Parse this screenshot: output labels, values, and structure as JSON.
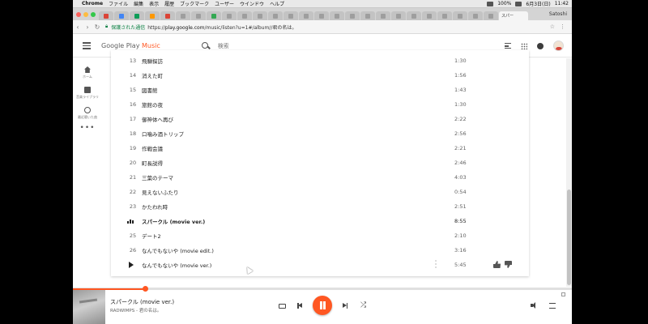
{
  "os_menubar": {
    "app_name": "Chrome",
    "menus": [
      "ファイル",
      "編集",
      "表示",
      "履歴",
      "ブックマーク",
      "ユーザー",
      "ウインドウ",
      "ヘルプ"
    ],
    "battery": "100%",
    "date": "6月3日(日)",
    "time": "11:42"
  },
  "browser": {
    "active_tab_label": "スパー",
    "profile_name": "Satoshi",
    "traffic_light_colors": [
      "#fc605b",
      "#fdbc40",
      "#34c84a"
    ],
    "tab_favicon_colors": [
      "#db4437",
      "#4285f4",
      "#0f9d58",
      "#ff9800",
      "#db4437",
      "#9e9e9e",
      "#9e9e9e",
      "#34a853",
      "#9e9e9e",
      "#9e9e9e",
      "#9e9e9e",
      "#9e9e9e",
      "#9e9e9e",
      "#9e9e9e",
      "#9e9e9e",
      "#9e9e9e",
      "#9e9e9e",
      "#9e9e9e",
      "#9e9e9e",
      "#9e9e9e",
      "#9e9e9e",
      "#9e9e9e",
      "#9e9e9e",
      "#9e9e9e",
      "#9e9e9e",
      "#9e9e9e"
    ],
    "secure_label": "保護された通信",
    "url_scheme": "https://",
    "url_host": "play.google.com",
    "url_path": "/music/listen?u=1#/album//君の名は。"
  },
  "app": {
    "logo_prefix": "Google Play",
    "logo_suffix": "Music",
    "accent_color": "#ff5722",
    "search_placeholder": "検索"
  },
  "leftnav": {
    "items": [
      {
        "label": "ホーム",
        "icon": "home-icon"
      },
      {
        "label": "音楽ライブラリ",
        "icon": "library-icon"
      },
      {
        "label": "最近聴いた曲",
        "icon": "recent-icon"
      }
    ],
    "more_label": "•••"
  },
  "tracks": [
    {
      "num": "13",
      "title": "飛騨探訪",
      "duration": "1:30"
    },
    {
      "num": "14",
      "title": "消えた町",
      "duration": "1:56"
    },
    {
      "num": "15",
      "title": "図書館",
      "duration": "1:43"
    },
    {
      "num": "16",
      "title": "旅館の夜",
      "duration": "1:30"
    },
    {
      "num": "17",
      "title": "御神体へ再び",
      "duration": "2:22"
    },
    {
      "num": "18",
      "title": "口噛み酒トリップ",
      "duration": "2:56"
    },
    {
      "num": "19",
      "title": "作戦会議",
      "duration": "2:21"
    },
    {
      "num": "20",
      "title": "町長説得",
      "duration": "2:46"
    },
    {
      "num": "21",
      "title": "三葉のテーマ",
      "duration": "4:03"
    },
    {
      "num": "22",
      "title": "見えないふたり",
      "duration": "0:54"
    },
    {
      "num": "23",
      "title": "かたわれ時",
      "duration": "2:51"
    },
    {
      "num": "",
      "title": "スパークル (movie ver.)",
      "duration": "8:55",
      "playing": true
    },
    {
      "num": "25",
      "title": "デート2",
      "duration": "2:10"
    },
    {
      "num": "26",
      "title": "なんでもないや (movie edit.)",
      "duration": "3:16"
    },
    {
      "num": "",
      "title": "なんでもないや (movie ver.)",
      "duration": "5:45",
      "hovered": true
    }
  ],
  "now_playing": {
    "title": "スパークル (movie ver.)",
    "artist_album": "RADWIMPS - 君の名は。",
    "progress": 0.145
  }
}
